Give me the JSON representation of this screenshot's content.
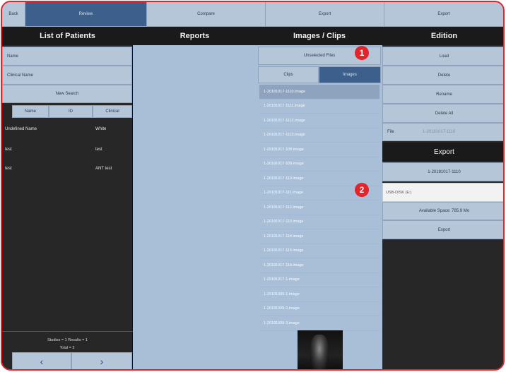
{
  "topbar": {
    "back": "Back",
    "review": "Review",
    "compare": "Compare",
    "export1": "Export",
    "export2": "Export"
  },
  "headers": {
    "patients": "List of Patients",
    "reports": "Reports",
    "images": "Images / Clips",
    "edition": "Edition"
  },
  "patients": {
    "name_field": "Name",
    "clinical_field": "Clinical Name",
    "new_search": "New Search",
    "columns": [
      "Name",
      "ID",
      "Clinical"
    ],
    "rows": [
      [
        "Undefined Name",
        "",
        "White"
      ],
      [
        "test",
        "",
        "test"
      ],
      [
        "test",
        "",
        "ANT test"
      ]
    ],
    "status_1": "Studies = 1  Results = 1",
    "status_2": "Total = 3",
    "prev": "‹",
    "next": "›"
  },
  "images": {
    "unselect_all": "Unselected Files",
    "tab_clips": "Clips",
    "tab_images": "Images",
    "files": [
      "1-20181017-1110.image",
      "1-20181017-1111.image",
      "1-20181017-1112.image",
      "1-20181017-1113.image",
      "1-20181017-108.image",
      "1-20181017-109.image",
      "1-20181017-110.image",
      "1-20181017-111.image",
      "1-20181017-112.image",
      "1-20181017-113.image",
      "1-20181017-114.image",
      "1-20181017-115.image",
      "1-20181017-116.image",
      "1-20181017-1.image",
      "1-20181009-1.image",
      "1-20181009-2.image",
      "1-20181009-3.image"
    ],
    "selected_index": 0
  },
  "edition": {
    "load": "Load",
    "delete": "Delete",
    "rename": "Rename",
    "delete_all": "Delete All",
    "file_label": "File",
    "file_value": "1-20181017-1110",
    "export_title": "Export",
    "export_file": "1-20181017-1110",
    "drive": "USB-DISK (E:)",
    "available_space": "Available Space: 785.9 Mo",
    "export_button": "Export"
  },
  "callouts": [
    "1",
    "2"
  ],
  "colors": {
    "accent": "#e3242b",
    "panel_light": "#a9bfd8",
    "panel_dark": "#272727",
    "button": "#b5c6d9",
    "active_tab": "#3c5f8c"
  }
}
